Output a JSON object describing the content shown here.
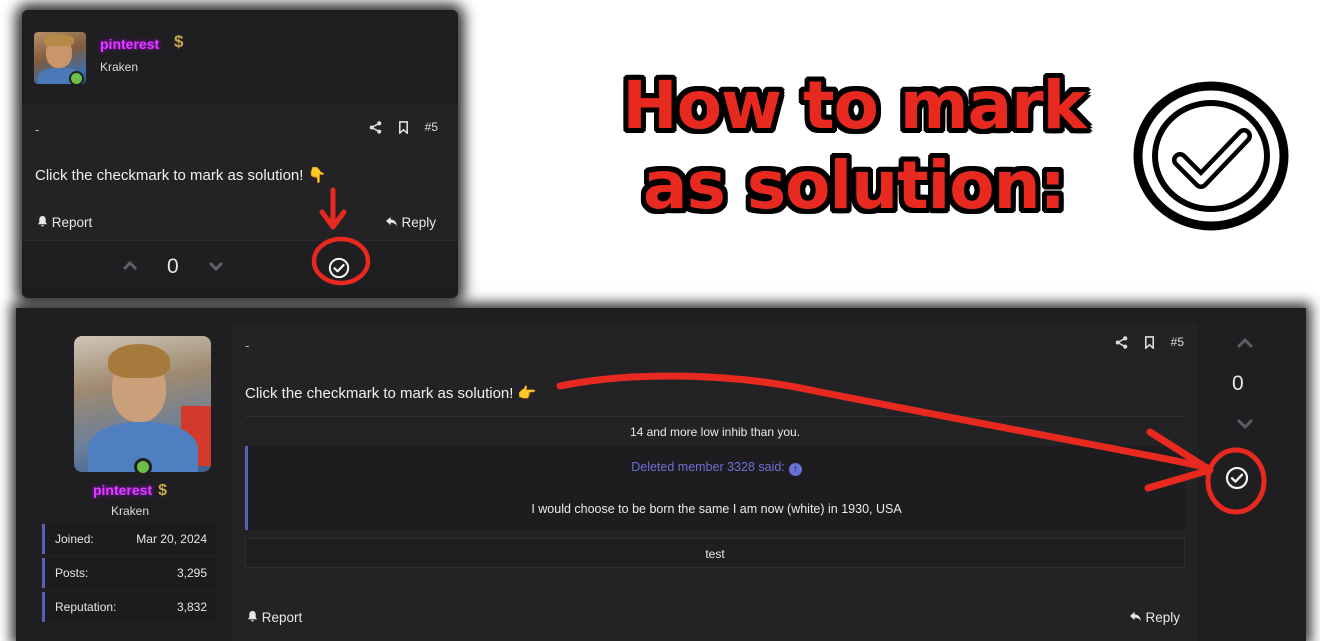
{
  "headline": {
    "line1": "How to mark",
    "line2": "as solution:"
  },
  "small_post": {
    "username": "pinterest",
    "dollar_badge": "$",
    "role": "Kraken",
    "separator": "-",
    "post_number": "#5",
    "message": "Click the checkmark to mark as solution! 👇",
    "report_label": "Report",
    "reply_label": "Reply",
    "score": "0"
  },
  "large_post": {
    "username": "pinterest",
    "dollar_badge": "$",
    "role": "Kraken",
    "stats": [
      {
        "key": "Joined:",
        "value": "Mar 20, 2024"
      },
      {
        "key": "Posts:",
        "value": "3,295"
      },
      {
        "key": "Reputation:",
        "value": "3,832"
      }
    ],
    "separator": "-",
    "post_number": "#5",
    "message": "Click the checkmark to mark as solution! 👉",
    "line1": "14 and more low inhib than you.",
    "quote_author": "Deleted member 3328 said:",
    "quote_body": "I would choose to be born the same I am now (white) in 1930, USA",
    "line2": "test",
    "report_label": "Report",
    "reply_label": "Reply",
    "score": "0"
  },
  "colors": {
    "annotation_red": "#e8291f",
    "username_magenta": "#e040fb",
    "online_green": "#6cc04a",
    "quote_accent": "#5a5fb3"
  },
  "icons": [
    "share-icon",
    "bookmark-icon",
    "bell-icon",
    "reply-icon",
    "chevron-up-icon",
    "chevron-down-icon",
    "checkmark-circle-icon"
  ]
}
